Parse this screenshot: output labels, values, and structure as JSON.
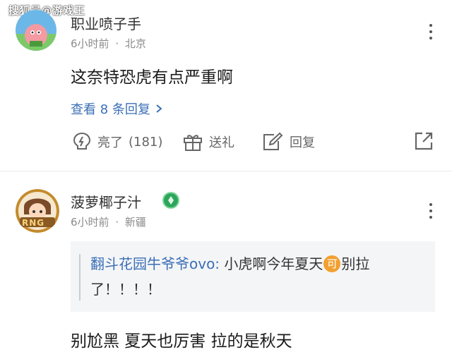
{
  "watermark": "搜狐号@游戏王",
  "comment1": {
    "username": "职业喷子手",
    "time": "6小时前",
    "separator": "·",
    "location": "北京",
    "content": "这奈特恐虎有点严重啊",
    "view_replies": "查看 8 条回复",
    "like_label": "亮了",
    "like_count": "(181)",
    "gift_label": "送礼",
    "reply_label": "回复"
  },
  "comment2": {
    "username": "菠萝椰子汁",
    "time": "6小时前",
    "separator": "·",
    "location": "新疆",
    "avatar_text": "RNG",
    "quote_user": "翻斗花园牛爷爷ovo:",
    "quote_text_1": " 小虎啊今年夏天",
    "quote_emoji": "可",
    "quote_text_2": "别拉了！！！！",
    "content": "别尬黑 夏天也厉害 拉的是秋天"
  },
  "colors": {
    "link": "#3b6fb6",
    "meta": "#8a8a8a",
    "quote_bg": "#f4f5f7"
  }
}
